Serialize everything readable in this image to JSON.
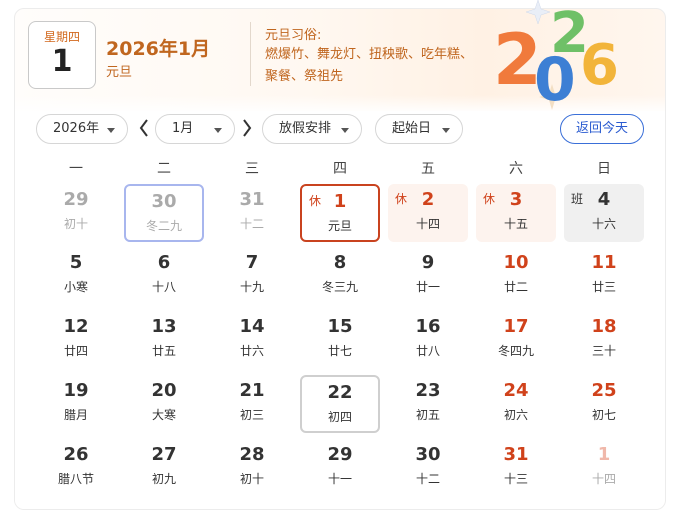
{
  "header": {
    "weekday": "星期四",
    "day": "1",
    "year_month": "2026年1月",
    "festival": "元旦",
    "customs_title": "元旦习俗:",
    "customs_text": "燃爆竹、舞龙灯、扭秧歌、吃年糕、聚餐、祭祖先"
  },
  "toolbar": {
    "year": "2026年",
    "month": "1月",
    "holiday": "放假安排",
    "start_day": "起始日",
    "today": "返回今天"
  },
  "weekdays": [
    "一",
    "二",
    "三",
    "四",
    "五",
    "六",
    "日"
  ],
  "weeks": [
    [
      {
        "d": "29",
        "l": "初十",
        "other": true
      },
      {
        "d": "30",
        "l": "冬二九",
        "other": true,
        "sel": "blue"
      },
      {
        "d": "31",
        "l": "十二",
        "other": true
      },
      {
        "d": "1",
        "l": "元旦",
        "today": true,
        "tag": "休"
      },
      {
        "d": "2",
        "l": "十四",
        "holiday": true,
        "tag": "休"
      },
      {
        "d": "3",
        "l": "十五",
        "holiday": true,
        "tag": "休"
      },
      {
        "d": "4",
        "l": "十六",
        "work": true,
        "tag": "班"
      }
    ],
    [
      {
        "d": "5",
        "l": "小寒"
      },
      {
        "d": "6",
        "l": "十八"
      },
      {
        "d": "7",
        "l": "十九"
      },
      {
        "d": "8",
        "l": "冬三九"
      },
      {
        "d": "9",
        "l": "廿一"
      },
      {
        "d": "10",
        "l": "廿二",
        "weekend": true
      },
      {
        "d": "11",
        "l": "廿三",
        "weekend": true
      }
    ],
    [
      {
        "d": "12",
        "l": "廿四"
      },
      {
        "d": "13",
        "l": "廿五"
      },
      {
        "d": "14",
        "l": "廿六"
      },
      {
        "d": "15",
        "l": "廿七"
      },
      {
        "d": "16",
        "l": "廿八"
      },
      {
        "d": "17",
        "l": "冬四九",
        "weekend": true
      },
      {
        "d": "18",
        "l": "三十",
        "weekend": true
      }
    ],
    [
      {
        "d": "19",
        "l": "腊月"
      },
      {
        "d": "20",
        "l": "大寒"
      },
      {
        "d": "21",
        "l": "初三"
      },
      {
        "d": "22",
        "l": "初四",
        "sel": "gray"
      },
      {
        "d": "23",
        "l": "初五"
      },
      {
        "d": "24",
        "l": "初六",
        "weekend": true
      },
      {
        "d": "25",
        "l": "初七",
        "weekend": true
      }
    ],
    [
      {
        "d": "26",
        "l": "腊八节"
      },
      {
        "d": "27",
        "l": "初九"
      },
      {
        "d": "28",
        "l": "初十"
      },
      {
        "d": "29",
        "l": "十一"
      },
      {
        "d": "30",
        "l": "十二"
      },
      {
        "d": "31",
        "l": "十三",
        "weekend": true
      },
      {
        "d": "1",
        "l": "十四",
        "weekend": true,
        "other": true
      }
    ]
  ],
  "art_text": "2026",
  "colors": {
    "accent": "#c0661f",
    "holiday_red": "#d0421b",
    "link_blue": "#2a5bd0"
  }
}
